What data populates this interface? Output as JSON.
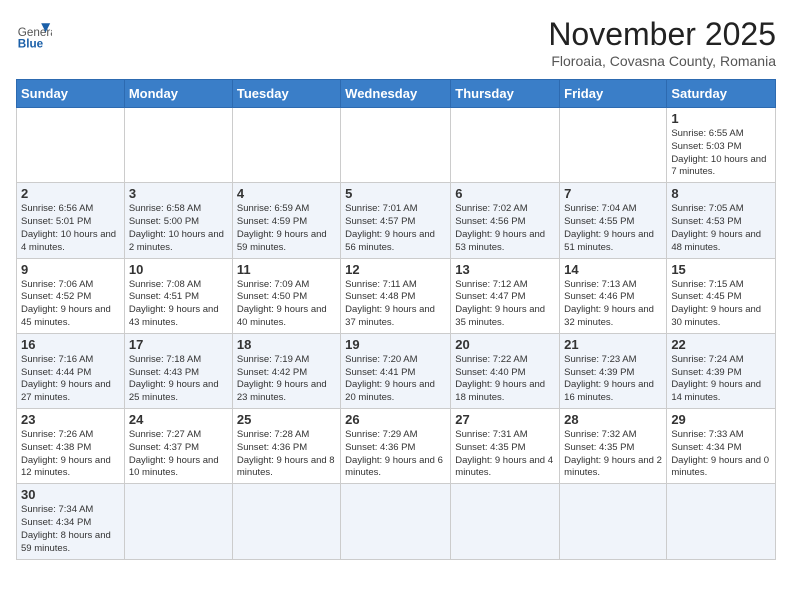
{
  "header": {
    "logo_text_general": "General",
    "logo_text_blue": "Blue",
    "month": "November 2025",
    "location": "Floroaia, Covasna County, Romania"
  },
  "weekdays": [
    "Sunday",
    "Monday",
    "Tuesday",
    "Wednesday",
    "Thursday",
    "Friday",
    "Saturday"
  ],
  "weeks": [
    [
      {
        "day": "",
        "info": ""
      },
      {
        "day": "",
        "info": ""
      },
      {
        "day": "",
        "info": ""
      },
      {
        "day": "",
        "info": ""
      },
      {
        "day": "",
        "info": ""
      },
      {
        "day": "",
        "info": ""
      },
      {
        "day": "1",
        "info": "Sunrise: 6:55 AM\nSunset: 5:03 PM\nDaylight: 10 hours and 7 minutes."
      }
    ],
    [
      {
        "day": "2",
        "info": "Sunrise: 6:56 AM\nSunset: 5:01 PM\nDaylight: 10 hours and 4 minutes."
      },
      {
        "day": "3",
        "info": "Sunrise: 6:58 AM\nSunset: 5:00 PM\nDaylight: 10 hours and 2 minutes."
      },
      {
        "day": "4",
        "info": "Sunrise: 6:59 AM\nSunset: 4:59 PM\nDaylight: 9 hours and 59 minutes."
      },
      {
        "day": "5",
        "info": "Sunrise: 7:01 AM\nSunset: 4:57 PM\nDaylight: 9 hours and 56 minutes."
      },
      {
        "day": "6",
        "info": "Sunrise: 7:02 AM\nSunset: 4:56 PM\nDaylight: 9 hours and 53 minutes."
      },
      {
        "day": "7",
        "info": "Sunrise: 7:04 AM\nSunset: 4:55 PM\nDaylight: 9 hours and 51 minutes."
      },
      {
        "day": "8",
        "info": "Sunrise: 7:05 AM\nSunset: 4:53 PM\nDaylight: 9 hours and 48 minutes."
      }
    ],
    [
      {
        "day": "9",
        "info": "Sunrise: 7:06 AM\nSunset: 4:52 PM\nDaylight: 9 hours and 45 minutes."
      },
      {
        "day": "10",
        "info": "Sunrise: 7:08 AM\nSunset: 4:51 PM\nDaylight: 9 hours and 43 minutes."
      },
      {
        "day": "11",
        "info": "Sunrise: 7:09 AM\nSunset: 4:50 PM\nDaylight: 9 hours and 40 minutes."
      },
      {
        "day": "12",
        "info": "Sunrise: 7:11 AM\nSunset: 4:48 PM\nDaylight: 9 hours and 37 minutes."
      },
      {
        "day": "13",
        "info": "Sunrise: 7:12 AM\nSunset: 4:47 PM\nDaylight: 9 hours and 35 minutes."
      },
      {
        "day": "14",
        "info": "Sunrise: 7:13 AM\nSunset: 4:46 PM\nDaylight: 9 hours and 32 minutes."
      },
      {
        "day": "15",
        "info": "Sunrise: 7:15 AM\nSunset: 4:45 PM\nDaylight: 9 hours and 30 minutes."
      }
    ],
    [
      {
        "day": "16",
        "info": "Sunrise: 7:16 AM\nSunset: 4:44 PM\nDaylight: 9 hours and 27 minutes."
      },
      {
        "day": "17",
        "info": "Sunrise: 7:18 AM\nSunset: 4:43 PM\nDaylight: 9 hours and 25 minutes."
      },
      {
        "day": "18",
        "info": "Sunrise: 7:19 AM\nSunset: 4:42 PM\nDaylight: 9 hours and 23 minutes."
      },
      {
        "day": "19",
        "info": "Sunrise: 7:20 AM\nSunset: 4:41 PM\nDaylight: 9 hours and 20 minutes."
      },
      {
        "day": "20",
        "info": "Sunrise: 7:22 AM\nSunset: 4:40 PM\nDaylight: 9 hours and 18 minutes."
      },
      {
        "day": "21",
        "info": "Sunrise: 7:23 AM\nSunset: 4:39 PM\nDaylight: 9 hours and 16 minutes."
      },
      {
        "day": "22",
        "info": "Sunrise: 7:24 AM\nSunset: 4:39 PM\nDaylight: 9 hours and 14 minutes."
      }
    ],
    [
      {
        "day": "23",
        "info": "Sunrise: 7:26 AM\nSunset: 4:38 PM\nDaylight: 9 hours and 12 minutes."
      },
      {
        "day": "24",
        "info": "Sunrise: 7:27 AM\nSunset: 4:37 PM\nDaylight: 9 hours and 10 minutes."
      },
      {
        "day": "25",
        "info": "Sunrise: 7:28 AM\nSunset: 4:36 PM\nDaylight: 9 hours and 8 minutes."
      },
      {
        "day": "26",
        "info": "Sunrise: 7:29 AM\nSunset: 4:36 PM\nDaylight: 9 hours and 6 minutes."
      },
      {
        "day": "27",
        "info": "Sunrise: 7:31 AM\nSunset: 4:35 PM\nDaylight: 9 hours and 4 minutes."
      },
      {
        "day": "28",
        "info": "Sunrise: 7:32 AM\nSunset: 4:35 PM\nDaylight: 9 hours and 2 minutes."
      },
      {
        "day": "29",
        "info": "Sunrise: 7:33 AM\nSunset: 4:34 PM\nDaylight: 9 hours and 0 minutes."
      }
    ],
    [
      {
        "day": "30",
        "info": "Sunrise: 7:34 AM\nSunset: 4:34 PM\nDaylight: 8 hours and 59 minutes."
      },
      {
        "day": "",
        "info": ""
      },
      {
        "day": "",
        "info": ""
      },
      {
        "day": "",
        "info": ""
      },
      {
        "day": "",
        "info": ""
      },
      {
        "day": "",
        "info": ""
      },
      {
        "day": "",
        "info": ""
      }
    ]
  ]
}
